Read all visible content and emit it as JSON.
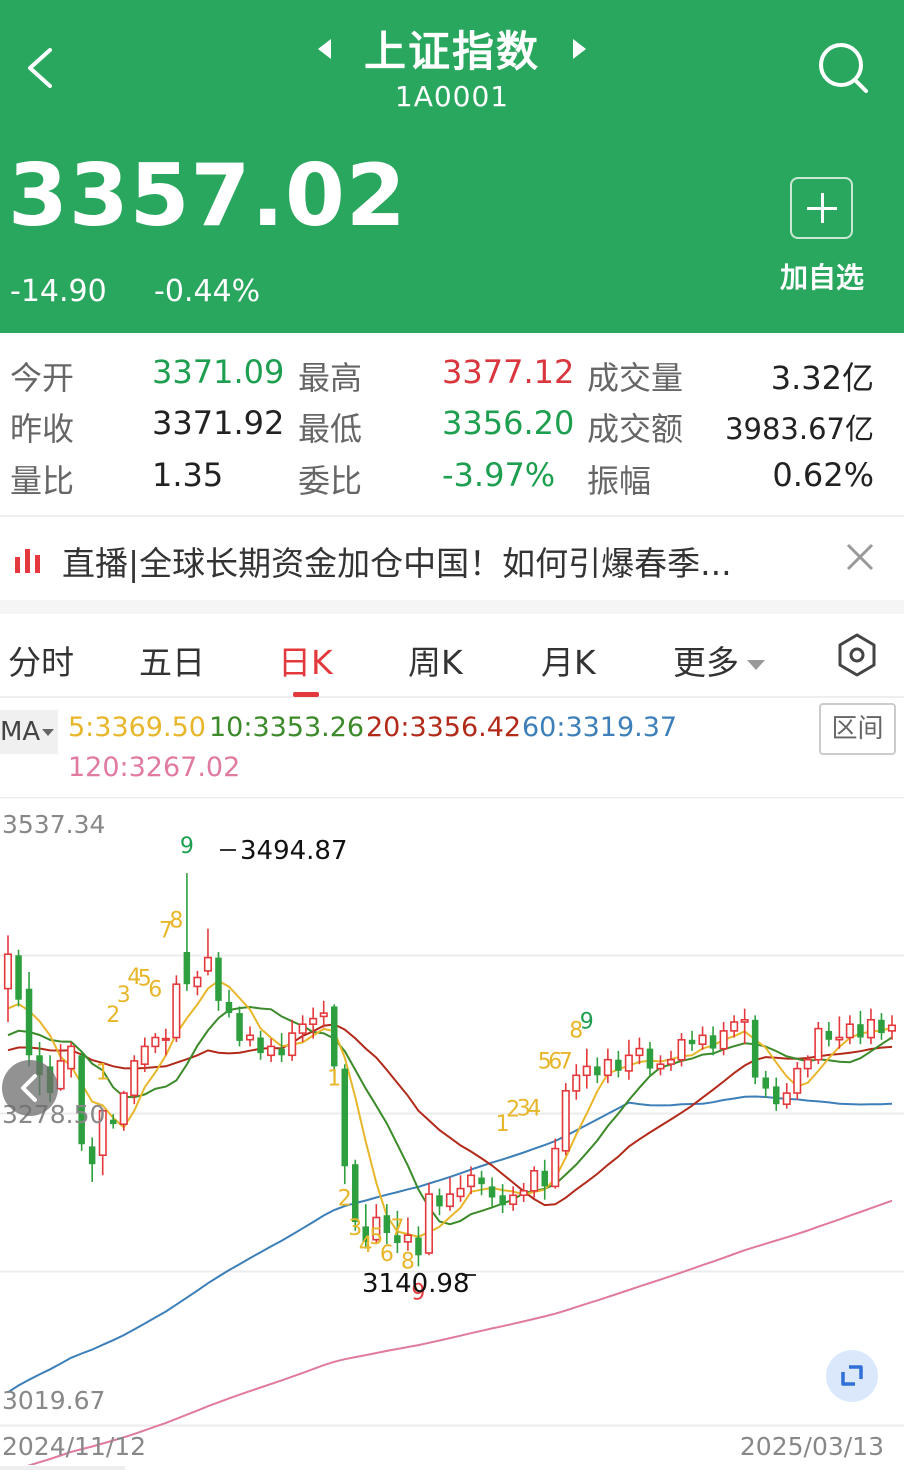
{
  "header": {
    "title": "上证指数",
    "code": "1A0001",
    "price": "3357.02",
    "change": "-14.90",
    "change_pct": "-0.44%",
    "add_label": "加自选",
    "bg_color": "#2aa75e"
  },
  "stats": {
    "open_label": "今开",
    "open": "3371.09",
    "high_label": "最高",
    "high": "3377.12",
    "volume_label": "成交量",
    "volume": "3.32亿",
    "prev_close_label": "昨收",
    "prev_close": "3371.92",
    "low_label": "最低",
    "low": "3356.20",
    "turnover_label": "成交额",
    "turnover": "3983.67亿",
    "vol_ratio_label": "量比",
    "vol_ratio": "1.35",
    "bid_ratio_label": "委比",
    "bid_ratio": "-3.97%",
    "amplitude_label": "振幅",
    "amplitude": "0.62%"
  },
  "news": {
    "text": "直播|全球长期资金加仓中国！如何引爆春季..."
  },
  "tabs": {
    "intraday": "分时",
    "five_day": "五日",
    "daily": "日K",
    "weekly": "周K",
    "monthly": "月K",
    "more": "更多"
  },
  "ma": {
    "button": "MA",
    "ma5": "5:3369.50",
    "ma10": "10:3353.26",
    "ma20": "20:3356.42",
    "ma60": "60:3319.37",
    "ma120": "120:3267.02",
    "range_button": "区间",
    "colors": {
      "ma5": "#e8b62a",
      "ma10": "#3c8a2a",
      "ma20": "#b22a1a",
      "ma60": "#3d7fb8",
      "ma120": "#e07aa0"
    }
  },
  "chart_data": {
    "type": "candlestick",
    "y_ticks": [
      "3537.34",
      "3278.50",
      "3019.67"
    ],
    "ylim": [
      3019.67,
      3537.34
    ],
    "max_label": "3494.87",
    "min_label": "3140.98",
    "start_date": "2024/11/12",
    "end_date": "2025/03/13",
    "up_color": "#e4393c",
    "down_color": "#2e9f3e",
    "td_marks": [
      {
        "t": "9",
        "i": 17,
        "v": 3512,
        "c": "#1e9f50"
      },
      {
        "t": "8",
        "i": 16,
        "v": 3445,
        "c": "#e8b62a"
      },
      {
        "t": "7",
        "i": 15,
        "v": 3436,
        "c": "#e8b62a"
      },
      {
        "t": "6",
        "i": 14,
        "v": 3383,
        "c": "#e8b62a"
      },
      {
        "t": "5",
        "i": 13,
        "v": 3393,
        "c": "#e8b62a"
      },
      {
        "t": "4",
        "i": 12,
        "v": 3394,
        "c": "#e8b62a"
      },
      {
        "t": "3",
        "i": 11,
        "v": 3378,
        "c": "#e8b62a"
      },
      {
        "t": "2",
        "i": 10,
        "v": 3360,
        "c": "#e8b62a"
      },
      {
        "t": "1",
        "i": 9,
        "v": 3308,
        "c": "#e8b62a"
      },
      {
        "t": "1",
        "i": 31,
        "v": 3303,
        "c": "#e8b62a"
      },
      {
        "t": "2",
        "i": 32,
        "v": 3195,
        "c": "#e8b62a"
      },
      {
        "t": "3",
        "i": 33,
        "v": 3168,
        "c": "#e8b62a"
      },
      {
        "t": "4",
        "i": 34,
        "v": 3153,
        "c": "#e8b62a"
      },
      {
        "t": "5",
        "i": 35,
        "v": 3160,
        "c": "#e8b62a"
      },
      {
        "t": "6",
        "i": 36,
        "v": 3145,
        "c": "#e8b62a"
      },
      {
        "t": "7",
        "i": 37,
        "v": 3168,
        "c": "#e8b62a"
      },
      {
        "t": "8",
        "i": 38,
        "v": 3138,
        "c": "#e8b62a"
      },
      {
        "t": "9",
        "i": 39,
        "v": 3110,
        "c": "#e4393c"
      },
      {
        "t": "1",
        "i": 47,
        "v": 3262,
        "c": "#e8b62a"
      },
      {
        "t": "2",
        "i": 48,
        "v": 3275,
        "c": "#e8b62a"
      },
      {
        "t": "3",
        "i": 49,
        "v": 3276,
        "c": "#e8b62a"
      },
      {
        "t": "4",
        "i": 50,
        "v": 3276,
        "c": "#e8b62a"
      },
      {
        "t": "5",
        "i": 51,
        "v": 3318,
        "c": "#e8b62a"
      },
      {
        "t": "6",
        "i": 52,
        "v": 3318,
        "c": "#e8b62a"
      },
      {
        "t": "7",
        "i": 53,
        "v": 3318,
        "c": "#e8b62a"
      },
      {
        "t": "8",
        "i": 54,
        "v": 3346,
        "c": "#e8b62a"
      },
      {
        "t": "9",
        "i": 55,
        "v": 3354,
        "c": "#1e9f50"
      }
    ],
    "candles": [
      [
        3390,
        3421,
        3360,
        3438
      ],
      [
        3420,
        3380,
        3374,
        3425
      ],
      [
        3390,
        3330,
        3320,
        3405
      ],
      [
        3330,
        3312,
        3294,
        3342
      ],
      [
        3320,
        3296,
        3288,
        3330
      ],
      [
        3300,
        3325,
        3298,
        3340
      ],
      [
        3318,
        3338,
        3310,
        3342
      ],
      [
        3330,
        3250,
        3244,
        3333
      ],
      [
        3248,
        3232,
        3216,
        3256
      ],
      [
        3240,
        3280,
        3222,
        3282
      ],
      [
        3272,
        3268,
        3264,
        3277
      ],
      [
        3268,
        3296,
        3262,
        3298
      ],
      [
        3294,
        3325,
        3286,
        3330
      ],
      [
        3322,
        3338,
        3315,
        3346
      ],
      [
        3338,
        3346,
        3332,
        3350
      ],
      [
        3344,
        3345,
        3330,
        3354
      ],
      [
        3346,
        3394,
        3342,
        3402
      ],
      [
        3423,
        3394,
        3388,
        3494
      ],
      [
        3392,
        3400,
        3384,
        3406
      ],
      [
        3406,
        3418,
        3402,
        3444
      ],
      [
        3418,
        3379,
        3370,
        3423
      ],
      [
        3378,
        3368,
        3364,
        3389
      ],
      [
        3368,
        3343,
        3338,
        3374
      ],
      [
        3344,
        3348,
        3338,
        3356
      ],
      [
        3346,
        3332,
        3326,
        3352
      ],
      [
        3330,
        3338,
        3324,
        3345
      ],
      [
        3336,
        3330,
        3324,
        3350
      ],
      [
        3330,
        3350,
        3325,
        3362
      ],
      [
        3350,
        3358,
        3342,
        3366
      ],
      [
        3358,
        3363,
        3345,
        3373
      ],
      [
        3365,
        3368,
        3355,
        3379
      ],
      [
        3374,
        3320,
        3310,
        3376
      ],
      [
        3318,
        3230,
        3214,
        3322
      ],
      [
        3232,
        3180,
        3172,
        3236
      ],
      [
        3176,
        3162,
        3156,
        3196
      ],
      [
        3164,
        3184,
        3160,
        3196
      ],
      [
        3186,
        3170,
        3160,
        3196
      ],
      [
        3168,
        3161,
        3152,
        3190
      ],
      [
        3162,
        3168,
        3154,
        3184
      ],
      [
        3166,
        3150,
        3140,
        3176
      ],
      [
        3152,
        3205,
        3150,
        3215
      ],
      [
        3204,
        3194,
        3186,
        3210
      ],
      [
        3194,
        3205,
        3190,
        3220
      ],
      [
        3203,
        3210,
        3198,
        3222
      ],
      [
        3212,
        3222,
        3205,
        3230
      ],
      [
        3220,
        3214,
        3204,
        3226
      ],
      [
        3212,
        3202,
        3194,
        3220
      ],
      [
        3204,
        3195,
        3188,
        3214
      ],
      [
        3196,
        3204,
        3190,
        3212
      ],
      [
        3204,
        3208,
        3198,
        3215
      ],
      [
        3208,
        3226,
        3202,
        3230
      ],
      [
        3226,
        3212,
        3200,
        3236
      ],
      [
        3212,
        3246,
        3210,
        3255
      ],
      [
        3244,
        3298,
        3240,
        3305
      ],
      [
        3298,
        3312,
        3290,
        3322
      ],
      [
        3312,
        3320,
        3300,
        3336
      ],
      [
        3320,
        3312,
        3305,
        3328
      ],
      [
        3312,
        3326,
        3305,
        3336
      ],
      [
        3326,
        3316,
        3310,
        3334
      ],
      [
        3316,
        3330,
        3308,
        3344
      ],
      [
        3330,
        3336,
        3322,
        3346
      ],
      [
        3336,
        3318,
        3312,
        3342
      ],
      [
        3318,
        3322,
        3312,
        3330
      ],
      [
        3322,
        3326,
        3316,
        3334
      ],
      [
        3326,
        3344,
        3320,
        3350
      ],
      [
        3344,
        3340,
        3334,
        3352
      ],
      [
        3340,
        3348,
        3335,
        3356
      ],
      [
        3348,
        3336,
        3330,
        3356
      ],
      [
        3336,
        3352,
        3330,
        3360
      ],
      [
        3352,
        3360,
        3346,
        3366
      ],
      [
        3360,
        3362,
        3340,
        3372
      ],
      [
        3362,
        3310,
        3304,
        3366
      ],
      [
        3310,
        3300,
        3292,
        3316
      ],
      [
        3302,
        3286,
        3280,
        3310
      ],
      [
        3286,
        3296,
        3282,
        3305
      ],
      [
        3296,
        3318,
        3290,
        3324
      ],
      [
        3318,
        3326,
        3310,
        3330
      ],
      [
        3326,
        3354,
        3322,
        3360
      ],
      [
        3352,
        3344,
        3338,
        3360
      ],
      [
        3344,
        3346,
        3336,
        3365
      ],
      [
        3346,
        3358,
        3340,
        3366
      ],
      [
        3358,
        3346,
        3340,
        3370
      ],
      [
        3346,
        3362,
        3340,
        3372
      ],
      [
        3362,
        3350,
        3344,
        3368
      ],
      [
        3352,
        3357,
        3344,
        3366
      ]
    ]
  }
}
